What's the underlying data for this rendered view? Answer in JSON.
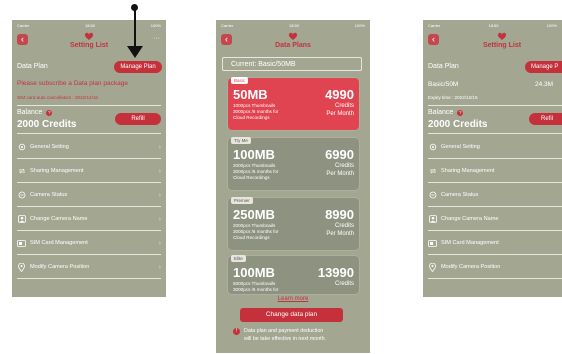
{
  "status": {
    "carrier": "Carrier",
    "time": "18:50",
    "battery": "100%"
  },
  "screen1": {
    "nav_title": "Setting List",
    "data_plan_label": "Data Plan",
    "manage_plan_label": "Manage Plan",
    "subscribe_prompt": "Please subscribe a Data plan package",
    "cancel_note": "SIM card auto cancellation : 2022/12/16",
    "balance_label": "Balance",
    "balance_value": "2000 Credits",
    "refill_label": "Refill",
    "menu": [
      {
        "label": "General Setting",
        "icon": "gear-icon"
      },
      {
        "label": "Sharing Management",
        "icon": "share-icon"
      },
      {
        "label": "Camera Status",
        "icon": "camera-status-icon"
      },
      {
        "label": "Change Camera Name",
        "icon": "camera-name-icon"
      },
      {
        "label": "SIM Card Management",
        "icon": "sim-card-icon"
      },
      {
        "label": "Modify Camera Position",
        "icon": "location-pin-icon"
      }
    ]
  },
  "screen2": {
    "nav_title": "Data Plans",
    "current_label": "Current:",
    "current_value": "Basic/50MB",
    "plans": [
      {
        "tag": "Basic",
        "size": "50MB",
        "d1": "1000pcs Thumbnails",
        "d2": "3000pcs /6 months for",
        "d3": "Cloud Recordings",
        "price": "4990",
        "credits": "Credits",
        "per": "Per Month"
      },
      {
        "tag": "Try Me",
        "size": "100MB",
        "d1": "2000pcs Thumbnails",
        "d2": "3000pcs /6 months for",
        "d3": "Cloud Recordings",
        "price": "6990",
        "credits": "Credits",
        "per": "Per Month"
      },
      {
        "tag": "Premier",
        "size": "250MB",
        "d1": "2000pcs Thumbnails",
        "d2": "3000pcs /6 months for",
        "d3": "Cloud Recordings",
        "price": "8990",
        "credits": "Credits",
        "per": "Per Month"
      },
      {
        "tag": "Elite",
        "size": "100MB",
        "d1": "5000pcs Thumbnails",
        "d2": "3000pcs /6 months for",
        "d3": "",
        "price": "13990",
        "credits": "Credits",
        "per": ""
      }
    ],
    "learn_more": "Learn more",
    "change_plan": "Change data plan",
    "notice_line1": "Data plan and payment deduction",
    "notice_line2": "will be take effective in next month."
  },
  "screen3": {
    "nav_title": "Setting List",
    "data_plan_label": "Data Plan",
    "manage_plan_label": "Manage P",
    "plan_value": "Basic/50M",
    "plan_usage": "24.3M",
    "expiry": "Expiry time : 2022/12/16",
    "balance_label": "Balance",
    "balance_value": "2000 Credits",
    "refill_label": "Refil",
    "menu": [
      {
        "label": "General Setting"
      },
      {
        "label": "Sharing Management"
      },
      {
        "label": "Camera Status"
      },
      {
        "label": "Change Camera Name"
      },
      {
        "label": "SIM Card Management"
      },
      {
        "label": "Modify Camera Position"
      }
    ]
  },
  "colors": {
    "screen_bg": "#a3a792",
    "accent": "#c4313b",
    "selected_card": "#e04450"
  }
}
